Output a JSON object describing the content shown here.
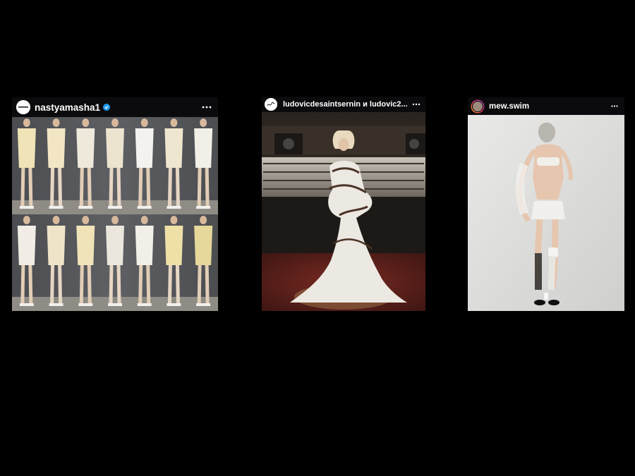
{
  "posts": [
    {
      "username": "nastyamasha1",
      "verified": true,
      "avatar_icon": "brand-logo-avatar-icon",
      "more_icon": "more-horizontal-icon"
    },
    {
      "username": "ludovicdesaintsernin и ludovic2...",
      "verified": false,
      "avatar_icon": "signature-avatar-icon",
      "more_icon": "more-horizontal-icon"
    },
    {
      "username": "mew.swim",
      "verified": false,
      "avatar_icon": "story-ring-avatar-icon",
      "more_icon": "more-horizontal-icon"
    }
  ],
  "colors": {
    "background": "#000000",
    "header": "#0b0b0d",
    "verified_badge": "#1d9bf0",
    "text": "#ffffff"
  }
}
